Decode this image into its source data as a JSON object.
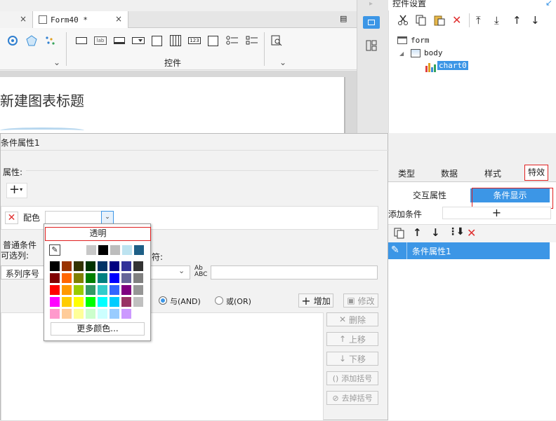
{
  "tabs": [
    {
      "label": "",
      "close": "×"
    },
    {
      "label": "Form40 *",
      "close": "×"
    }
  ],
  "toolbar": {
    "group_label": "控件",
    "chevron": "⌄"
  },
  "canvas": {
    "chart_title": "新建图表标题"
  },
  "right_panel": {
    "title": "控件设置",
    "tree": {
      "root": "form",
      "body": "body",
      "chart": "chart0"
    },
    "tabs": [
      "类型",
      "数据",
      "样式",
      "特效"
    ],
    "active_tab": "特效",
    "subtabs": [
      "交互属性",
      "条件显示"
    ],
    "active_subtab": "条件显示",
    "add_condition_label": "添加条件",
    "add_symbol": "+",
    "condition_item": "条件属性1"
  },
  "dialog": {
    "title": "条件属性1",
    "attr_label": "属性:",
    "add_symbol": "+",
    "color_label": "配色",
    "normal_condition": "普通条件",
    "selectable_label": "可选列:",
    "selected_value": "系列序号",
    "operator_partial": "符:",
    "and_label": "与(AND)",
    "or_label": "或(OR)",
    "add_btn": "增加",
    "modify_btn": "修改",
    "side_buttons": [
      "删除",
      "上移",
      "下移",
      "添加括号",
      "去掉括号"
    ]
  },
  "color_picker": {
    "transparent": "透明",
    "more_colors": "更多颜色...",
    "top_row": [
      "#ffffff",
      "#c7c7c7",
      "#000000",
      "#bdbdbd",
      "#bde3f0",
      "#1e5f86"
    ],
    "grid": [
      [
        "#000000",
        "#993300",
        "#333300",
        "#003300",
        "#003366",
        "#000080",
        "#333399",
        "#333333"
      ],
      [
        "#800000",
        "#ff6600",
        "#808000",
        "#008000",
        "#008080",
        "#0000ff",
        "#666699",
        "#808080"
      ],
      [
        "#ff0000",
        "#ff9900",
        "#99cc00",
        "#339966",
        "#33cccc",
        "#3366ff",
        "#800080",
        "#969696"
      ],
      [
        "#ff00ff",
        "#ffcc00",
        "#ffff00",
        "#00ff00",
        "#00ffff",
        "#00ccff",
        "#993366",
        "#c0c0c0"
      ],
      [
        "#ff99cc",
        "#ffcc99",
        "#ffff99",
        "#ccffcc",
        "#ccffff",
        "#99ccff",
        "#cc99ff",
        "#ffffff"
      ]
    ]
  },
  "colors": {
    "accent_blue": "#3c96e6",
    "red_x": "#e03030",
    "highlight_red": "#e02020"
  }
}
